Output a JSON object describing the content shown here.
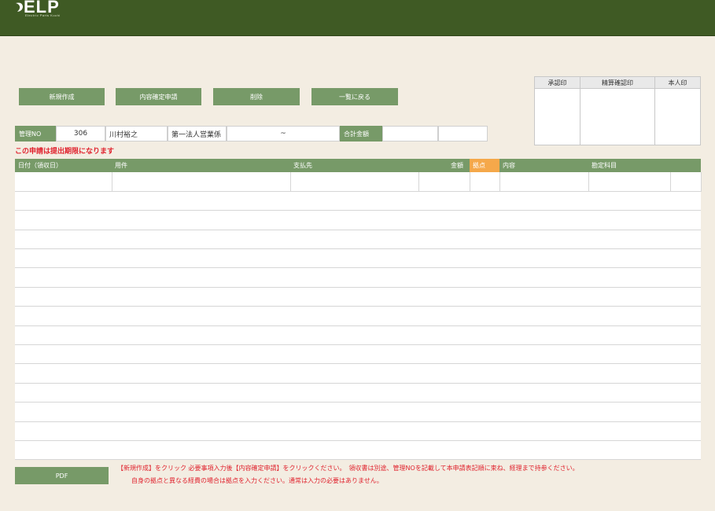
{
  "app": {
    "logo_text": "ELP",
    "logo_sub": "Electric Parts Kochi"
  },
  "toolbar": {
    "new_label": "新規作成",
    "confirm_label": "内容確定申請",
    "delete_label": "削除",
    "back_label": "一覧に戻る"
  },
  "stamps": {
    "headers": [
      "承認印",
      "精算確認印",
      "本人印"
    ]
  },
  "info": {
    "mgmt_label": "管理NO",
    "mgmt_no": "306",
    "name": "川村裕之",
    "department": "第一法人営業係",
    "period_sep": "~",
    "total_label": "合計金額",
    "total_value": ""
  },
  "warning": "この申請は提出期限になります",
  "grid": {
    "columns": [
      "日付（領収日）",
      "用件",
      "支払先",
      "金額",
      "拠点",
      "内容",
      "勘定科目"
    ]
  },
  "footer": {
    "pdf_label": "PDF",
    "note1": "【新規作成】をクリック 必要事項入力後【内容確定申請】をクリックください。　領収書は別途、管理NOを記載して本申請表記順に束ね、経理まで持参ください。",
    "note2": "自身の拠点と異なる経費の場合は拠点を入力ください。通常は入力の必要はありません。"
  }
}
